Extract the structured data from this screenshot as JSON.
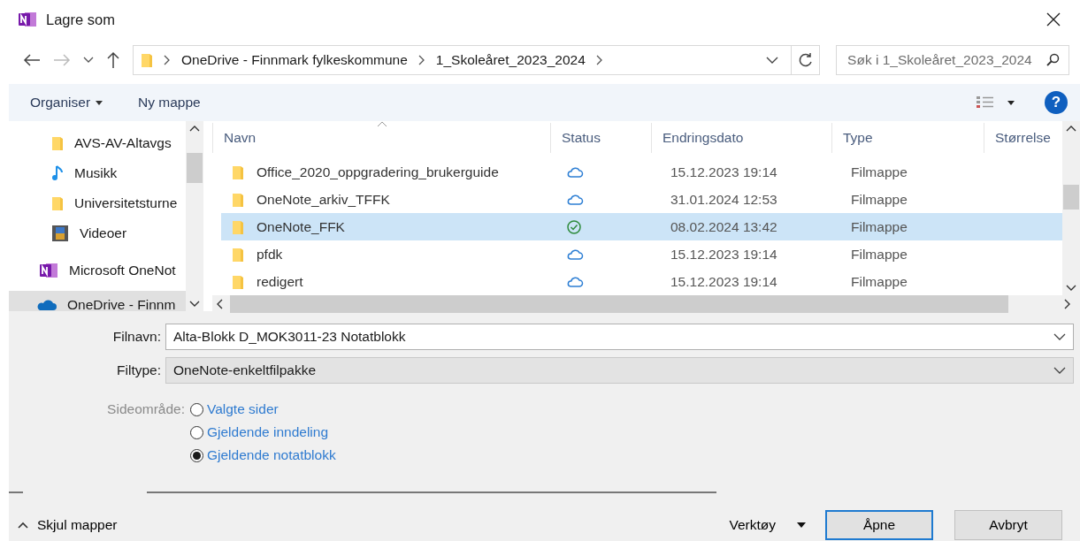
{
  "window": {
    "title": "Lagre som"
  },
  "address": {
    "segments": [
      "OneDrive - Finnmark fylkeskommune",
      "1_Skoleåret_2023_2024"
    ]
  },
  "search": {
    "placeholder": "Søk i 1_Skoleåret_2023_2024"
  },
  "toolbar": {
    "organize": "Organiser",
    "new_folder": "Ny mappe",
    "help": "?"
  },
  "sidebar": {
    "items": [
      {
        "label": "AVS-AV-Altavgs",
        "kind": "folder",
        "selected": false
      },
      {
        "label": "Musikk",
        "kind": "music",
        "selected": false
      },
      {
        "label": "Universitetsturne",
        "kind": "folder",
        "selected": false
      },
      {
        "label": "Videoer",
        "kind": "video",
        "selected": false
      },
      {
        "label": "Microsoft OneNot",
        "kind": "onenote",
        "selected": false
      },
      {
        "label": "OneDrive - Finnm",
        "kind": "onedrive",
        "selected": true
      }
    ]
  },
  "table": {
    "columns": [
      "Navn",
      "Status",
      "Endringsdato",
      "Type",
      "Størrelse"
    ],
    "rows": [
      {
        "name": "Office_2020_oppgradering_brukerguide",
        "kind": "cloud",
        "date": "15.12.2023 19:14",
        "type": "Filmappe",
        "selected": false
      },
      {
        "name": "OneNote_arkiv_TFFK",
        "kind": "cloud",
        "date": "31.01.2024 12:53",
        "type": "Filmappe",
        "selected": false
      },
      {
        "name": "OneNote_FFK",
        "kind": "synced",
        "date": "08.02.2024 13:42",
        "type": "Filmappe",
        "selected": true
      },
      {
        "name": "pfdk",
        "kind": "cloud",
        "date": "15.12.2023 19:14",
        "type": "Filmappe",
        "selected": false
      },
      {
        "name": "redigert",
        "kind": "cloud",
        "date": "15.12.2023 19:14",
        "type": "Filmappe",
        "selected": false
      }
    ]
  },
  "filename": {
    "label": "Filnavn:",
    "value": "Alta-Blokk D_MOK3011-23 Notatblokk"
  },
  "filetype": {
    "label": "Filtype:",
    "value": "OneNote-enkeltfilpakke"
  },
  "page_range": {
    "label": "Sideområde:",
    "options": [
      {
        "label": "Valgte sider",
        "selected": false
      },
      {
        "label": "Gjeldende inndeling",
        "selected": false
      },
      {
        "label": "Gjeldende notatblokk",
        "selected": true
      }
    ]
  },
  "footer": {
    "hide_folders": "Skjul mapper",
    "tools": "Verktøy",
    "open": "Åpne",
    "cancel": "Avbryt"
  }
}
